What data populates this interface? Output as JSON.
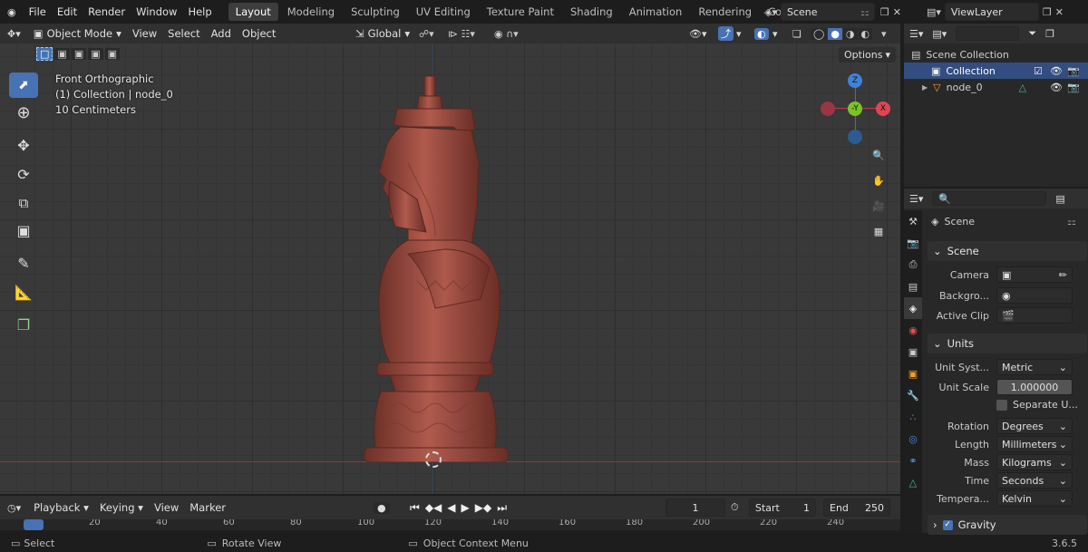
{
  "topbar": {
    "menus": [
      "File",
      "Edit",
      "Render",
      "Window",
      "Help"
    ],
    "workspaces": [
      "Layout",
      "Modeling",
      "Sculpting",
      "UV Editing",
      "Texture Paint",
      "Shading",
      "Animation",
      "Rendering",
      "Compositi"
    ],
    "scene": "Scene",
    "view_layer": "ViewLayer"
  },
  "viewport_header": {
    "mode": "Object Mode",
    "menus": [
      "View",
      "Select",
      "Add",
      "Object"
    ],
    "transform": "Global",
    "options": "Options"
  },
  "overlay": {
    "view": "Front Orthographic",
    "collection": "(1) Collection | node_0",
    "scale": "10 Centimeters"
  },
  "gizmo": {
    "z": "Z",
    "y": "-Y",
    "x": "X"
  },
  "outliner": {
    "root": "Scene Collection",
    "collection": "Collection",
    "object": "node_0"
  },
  "properties": {
    "breadcrumb": "Scene",
    "panel_scene": "Scene",
    "camera_label": "Camera",
    "background_label": "Backgro...",
    "clip_label": "Active Clip",
    "panel_units": "Units",
    "unit_system_label": "Unit Syst...",
    "unit_system": "Metric",
    "unit_scale_label": "Unit Scale",
    "unit_scale": "1.000000",
    "separate_units": "Separate U...",
    "rotation_label": "Rotation",
    "rotation": "Degrees",
    "length_label": "Length",
    "length": "Millimeters",
    "mass_label": "Mass",
    "mass": "Kilograms",
    "time_label": "Time",
    "time": "Seconds",
    "temp_label": "Tempera...",
    "temp": "Kelvin",
    "gravity": "Gravity"
  },
  "timeline": {
    "menus": [
      "Playback",
      "Keying",
      "View",
      "Marker"
    ],
    "current_frame": "1",
    "start_label": "Start",
    "start": "1",
    "end_label": "End",
    "end": "250",
    "ruler": [
      "20",
      "40",
      "60",
      "80",
      "100",
      "120",
      "140",
      "160",
      "180",
      "200",
      "220",
      "240"
    ]
  },
  "status": {
    "select": "Select",
    "rotate": "Rotate View",
    "context": "Object Context Menu",
    "version": "3.6.5"
  }
}
